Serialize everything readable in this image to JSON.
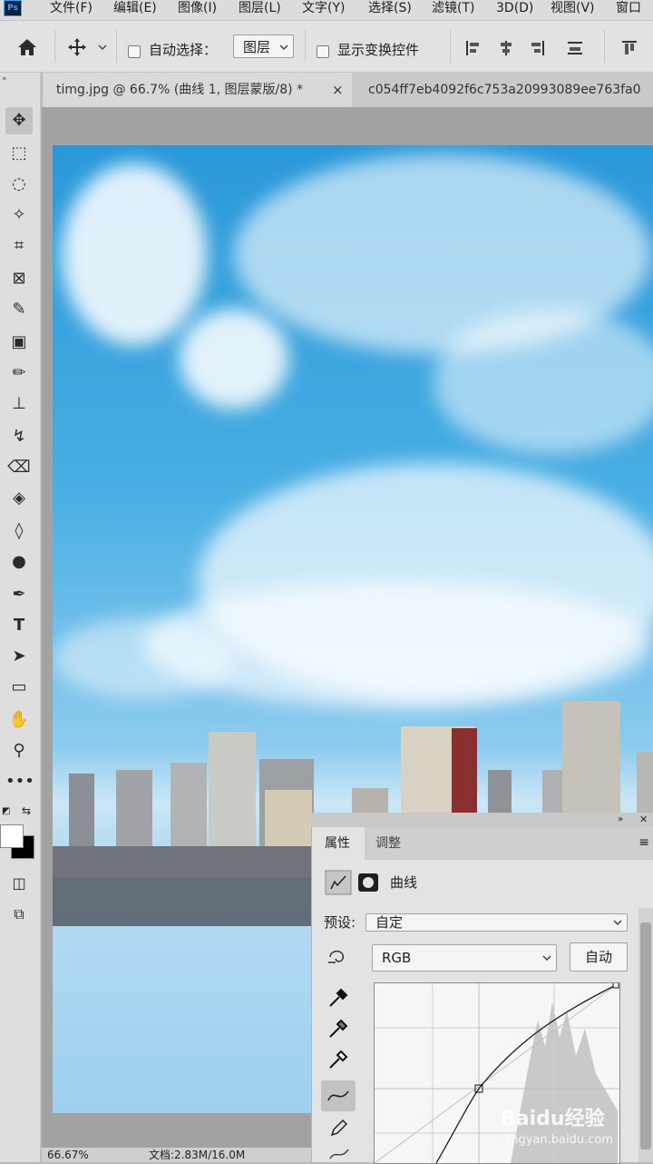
{
  "menu": {
    "logo": "Ps",
    "items": [
      "文件(F)",
      "编辑(E)",
      "图像(I)",
      "图层(L)",
      "文字(Y)",
      "选择(S)",
      "滤镜(T)",
      "3D(D)",
      "视图(V)",
      "窗口"
    ]
  },
  "options": {
    "auto_select_label": "自动选择：",
    "layer_select_value": "图层",
    "show_transform_label": "显示变换控件"
  },
  "tabs": [
    {
      "label": "timg.jpg @ 66.7% (曲线 1, 图层蒙版/8) *",
      "close": "×"
    },
    {
      "label": "c054ff7eb4092f6c753a20993089ee763fa0"
    }
  ],
  "tools": [
    "move-icon",
    "marquee-icon",
    "lasso-icon",
    "magic-wand-icon",
    "crop-icon",
    "frame-icon",
    "eyedropper-icon",
    "healing-icon",
    "brush-icon",
    "stamp-icon",
    "history-brush-icon",
    "eraser-icon",
    "paint-bucket-icon",
    "blur-icon",
    "dodge-icon",
    "pen-icon",
    "type-icon",
    "path-select-icon",
    "rectangle-icon",
    "hand-icon",
    "zoom-icon",
    "more-icon"
  ],
  "type_tool_glyph": "T",
  "properties": {
    "tab_properties": "属性",
    "tab_adjust": "调整",
    "curves_title": "曲线",
    "preset_label": "预设:",
    "preset_value": "自定",
    "channel_value": "RGB",
    "auto_button": "自动"
  },
  "status": {
    "zoom": "66.67%",
    "doc": "文档:2.83M/16.0M"
  },
  "watermark": {
    "text": "Baidu经验",
    "url": "jingyan.baidu.com"
  },
  "colors": {
    "accent": "#31a8ff",
    "sky": "#2a98d8"
  }
}
